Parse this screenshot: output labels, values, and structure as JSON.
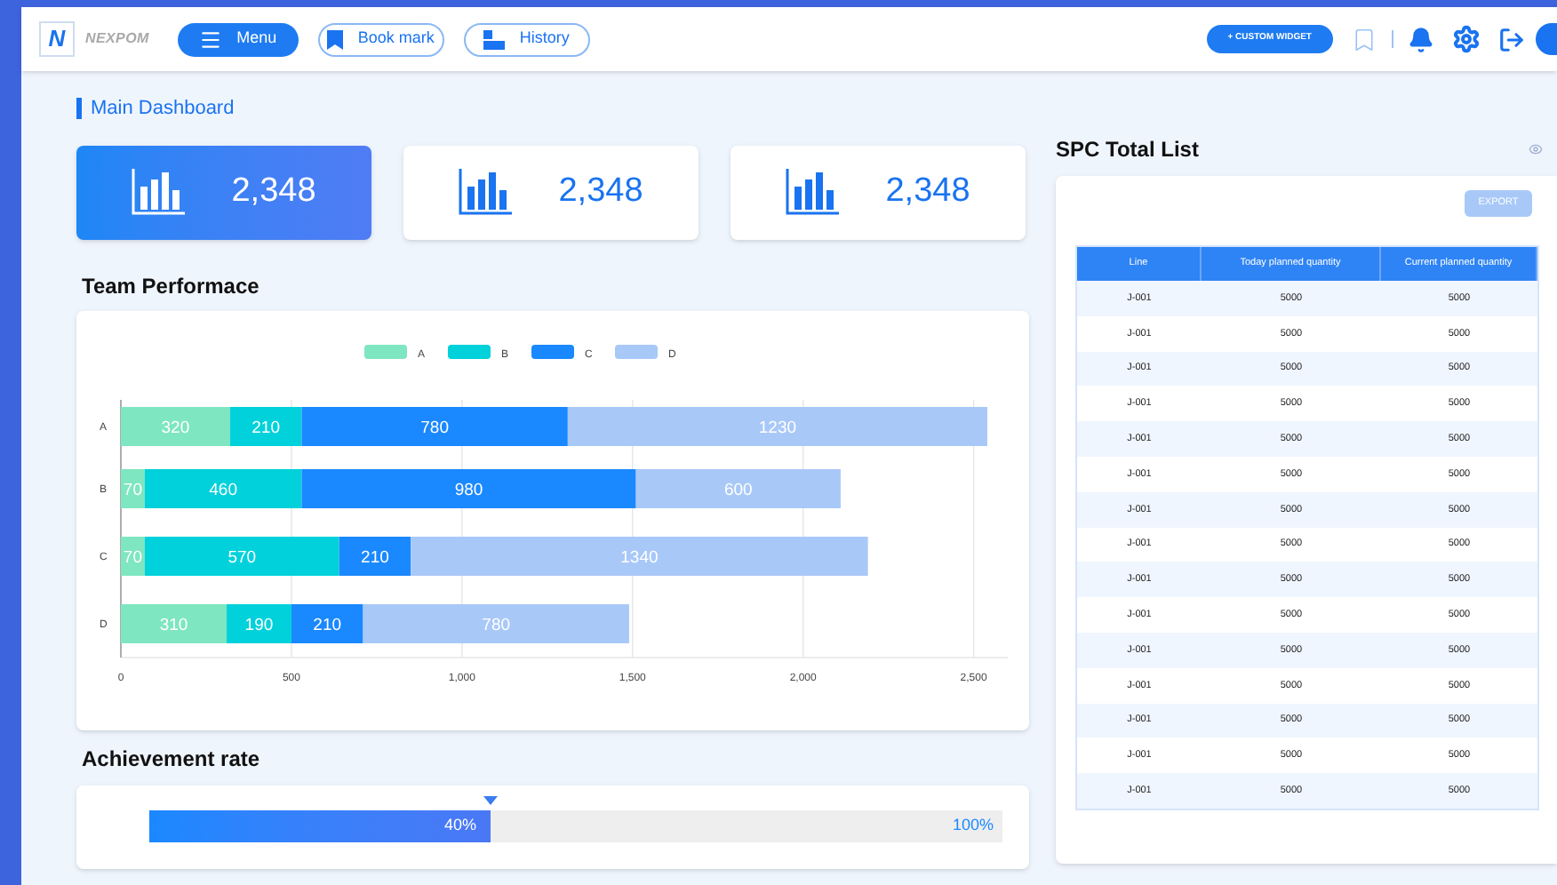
{
  "header": {
    "logo_letter": "N",
    "brand": "NEXPOM",
    "nav": [
      {
        "label": "Menu",
        "kind": "menu",
        "selected": true
      },
      {
        "label": "Book mark",
        "kind": "bookmark",
        "selected": false
      },
      {
        "label": "History",
        "kind": "history",
        "selected": false
      }
    ],
    "custom_widget": "+ CUSTOM WIDGET"
  },
  "page_title": "Main Dashboard",
  "stats": [
    {
      "value": "2,348",
      "selected": true
    },
    {
      "value": "2,348",
      "selected": false
    },
    {
      "value": "2,348",
      "selected": false
    }
  ],
  "team_performance": {
    "title": "Team Performace",
    "chart_data": {
      "type": "bar",
      "orientation": "horizontal",
      "stacked": true,
      "data_labels": true,
      "grid": true,
      "legend": true,
      "categories": [
        "A",
        "B",
        "C",
        "D"
      ],
      "xlim": [
        0,
        2600
      ],
      "xticks": [
        {
          "value": 0,
          "label": "0"
        },
        {
          "value": 500,
          "label": "500"
        },
        {
          "value": 1000,
          "label": "1,000"
        },
        {
          "value": 1500,
          "label": "1,500"
        },
        {
          "value": 2000,
          "label": "2,000"
        },
        {
          "value": 2500,
          "label": "2,500"
        }
      ],
      "series": [
        {
          "name": "A",
          "color": "#7ee6c0",
          "values": [
            320,
            70,
            70,
            310
          ]
        },
        {
          "name": "B",
          "color": "#00d1da",
          "values": [
            210,
            460,
            570,
            190
          ]
        },
        {
          "name": "C",
          "color": "#1a88ff",
          "values": [
            780,
            980,
            210,
            210
          ]
        },
        {
          "name": "D",
          "color": "#a8c8f8",
          "values": [
            1230,
            600,
            1340,
            780
          ]
        }
      ]
    }
  },
  "achievement": {
    "title": "Achievement rate",
    "level": 0.4,
    "reading": "40%",
    "max_label": "100%"
  },
  "spc": {
    "title": "SPC Total List",
    "export": "EXPORT",
    "columns": [
      "Line",
      "Today planned quantity",
      "Current planned quantity"
    ],
    "rows": [
      [
        "J-001",
        "5000",
        "5000"
      ],
      [
        "J-001",
        "5000",
        "5000"
      ],
      [
        "J-001",
        "5000",
        "5000"
      ],
      [
        "J-001",
        "5000",
        "5000"
      ],
      [
        "J-001",
        "5000",
        "5000"
      ],
      [
        "J-001",
        "5000",
        "5000"
      ],
      [
        "J-001",
        "5000",
        "5000"
      ],
      [
        "J-001",
        "5000",
        "5000"
      ],
      [
        "J-001",
        "5000",
        "5000"
      ],
      [
        "J-001",
        "5000",
        "5000"
      ],
      [
        "J-001",
        "5000",
        "5000"
      ],
      [
        "J-001",
        "5000",
        "5000"
      ],
      [
        "J-001",
        "5000",
        "5000"
      ],
      [
        "J-001",
        "5000",
        "5000"
      ],
      [
        "J-001",
        "5000",
        "5000"
      ]
    ]
  }
}
